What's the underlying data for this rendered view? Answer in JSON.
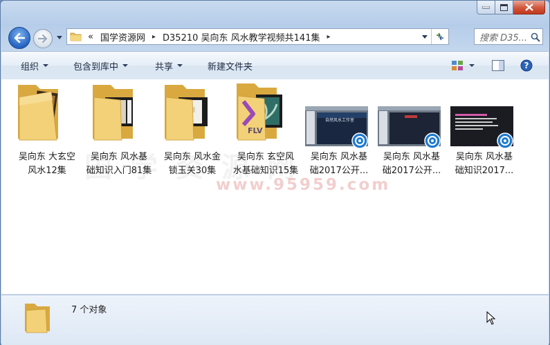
{
  "window": {
    "title": "",
    "accent": "#2564c0"
  },
  "address_bar": {
    "overflow": "«",
    "crumbs": [
      "国学资源网",
      "D35210 吴向东 风水教学视频共141集"
    ],
    "separator": "▸"
  },
  "search": {
    "placeholder": "搜索 D35..."
  },
  "toolbar": {
    "organize": "组织",
    "include_in_library": "包含到库中",
    "share": "共享",
    "new_folder": "新建文件夹"
  },
  "items": [
    {
      "type": "folder",
      "name": "吴向东 大玄空\n风水12集"
    },
    {
      "type": "folder",
      "name": "吴向东 风水基\n础知识入门81集"
    },
    {
      "type": "folder",
      "name": "吴向东 风水金\n锁玉关30集"
    },
    {
      "type": "folder",
      "name": "吴向东 玄空风\n水基础知识15集"
    },
    {
      "type": "video",
      "name": "吴向东 风水基\n础2017公开..."
    },
    {
      "type": "video",
      "name": "吴向东 风水基\n础2017公开..."
    },
    {
      "type": "video",
      "name": "吴向东 风水基\n础知识2017..."
    }
  ],
  "thumb_texts": {
    "flv": "FLV",
    "slide_title": "自然风水工作室"
  },
  "watermark": {
    "url": "www.95959.com",
    "cn": "国学资源网"
  },
  "details": {
    "count_text": "7 个对象"
  },
  "icons": [
    "back-arrow-icon",
    "forward-arrow-icon",
    "folder-icon",
    "refresh-icon",
    "search-icon",
    "view-options-icon",
    "preview-pane-icon",
    "help-icon",
    "video-badge-icon",
    "mouse-cursor-icon"
  ]
}
